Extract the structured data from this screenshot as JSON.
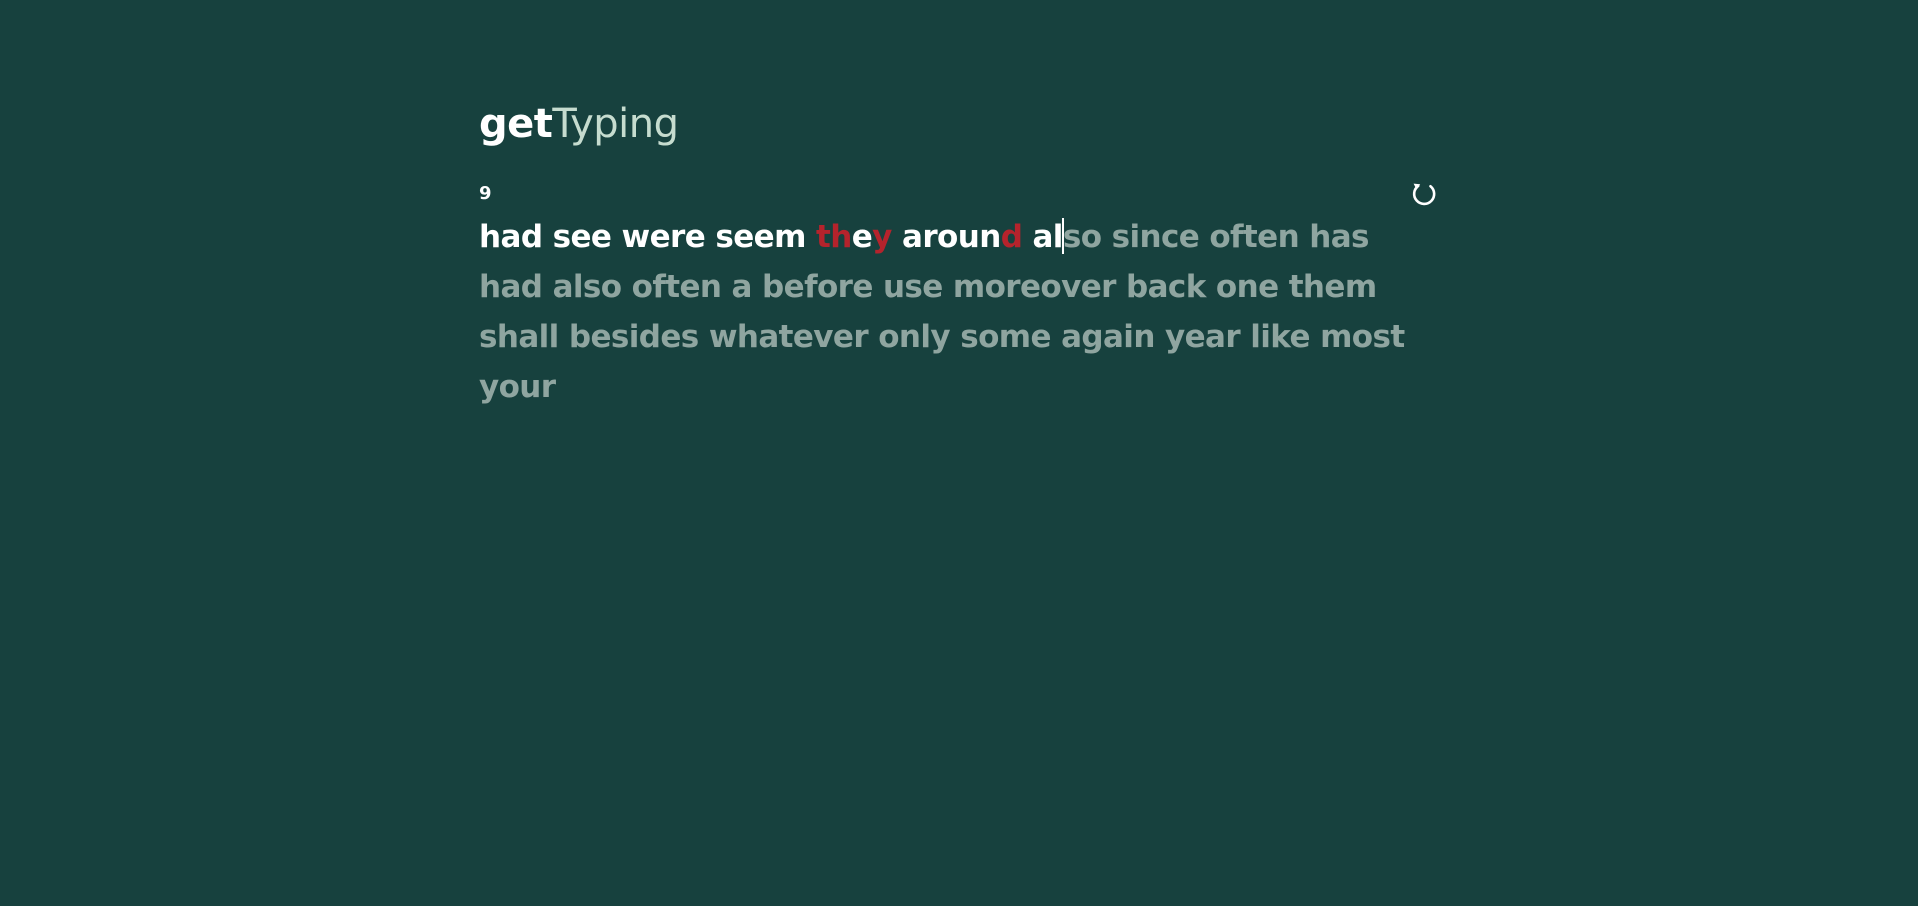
{
  "app": {
    "logo_part1": "get",
    "logo_part2": "Typing"
  },
  "test": {
    "word_count": "9",
    "restart_icon": "restart-icon",
    "words_typed": [
      {
        "chars": [
          [
            "h",
            "correct"
          ],
          [
            "a",
            "correct"
          ],
          [
            "d",
            "correct"
          ]
        ]
      },
      {
        "chars": [
          [
            "s",
            "correct"
          ],
          [
            "e",
            "correct"
          ],
          [
            "e",
            "correct"
          ]
        ]
      },
      {
        "chars": [
          [
            "w",
            "correct"
          ],
          [
            "e",
            "correct"
          ],
          [
            "r",
            "correct"
          ],
          [
            "e",
            "correct"
          ]
        ]
      },
      {
        "chars": [
          [
            "s",
            "correct"
          ],
          [
            "e",
            "correct"
          ],
          [
            "e",
            "correct"
          ],
          [
            "m",
            "correct"
          ]
        ]
      },
      {
        "chars": [
          [
            "t",
            "incorrect"
          ],
          [
            "h",
            "incorrect"
          ],
          [
            "e",
            "correct"
          ],
          [
            "y",
            "incorrect"
          ]
        ]
      },
      {
        "chars": [
          [
            "a",
            "correct"
          ],
          [
            "r",
            "correct"
          ],
          [
            "o",
            "correct"
          ],
          [
            "u",
            "correct"
          ],
          [
            "n",
            "correct"
          ],
          [
            "d",
            "incorrect"
          ]
        ]
      }
    ],
    "current_word_typed": "al",
    "current_word_remaining": "so",
    "upcoming_words": "since often has had also often a before use moreover back one them shall besides whatever only some again year like most your"
  },
  "colors": {
    "background": "#17413e",
    "correct": "#ffffff",
    "incorrect": "#b5232c",
    "pending": "#8fa5a0",
    "logo_accent": "#c6dccf"
  }
}
